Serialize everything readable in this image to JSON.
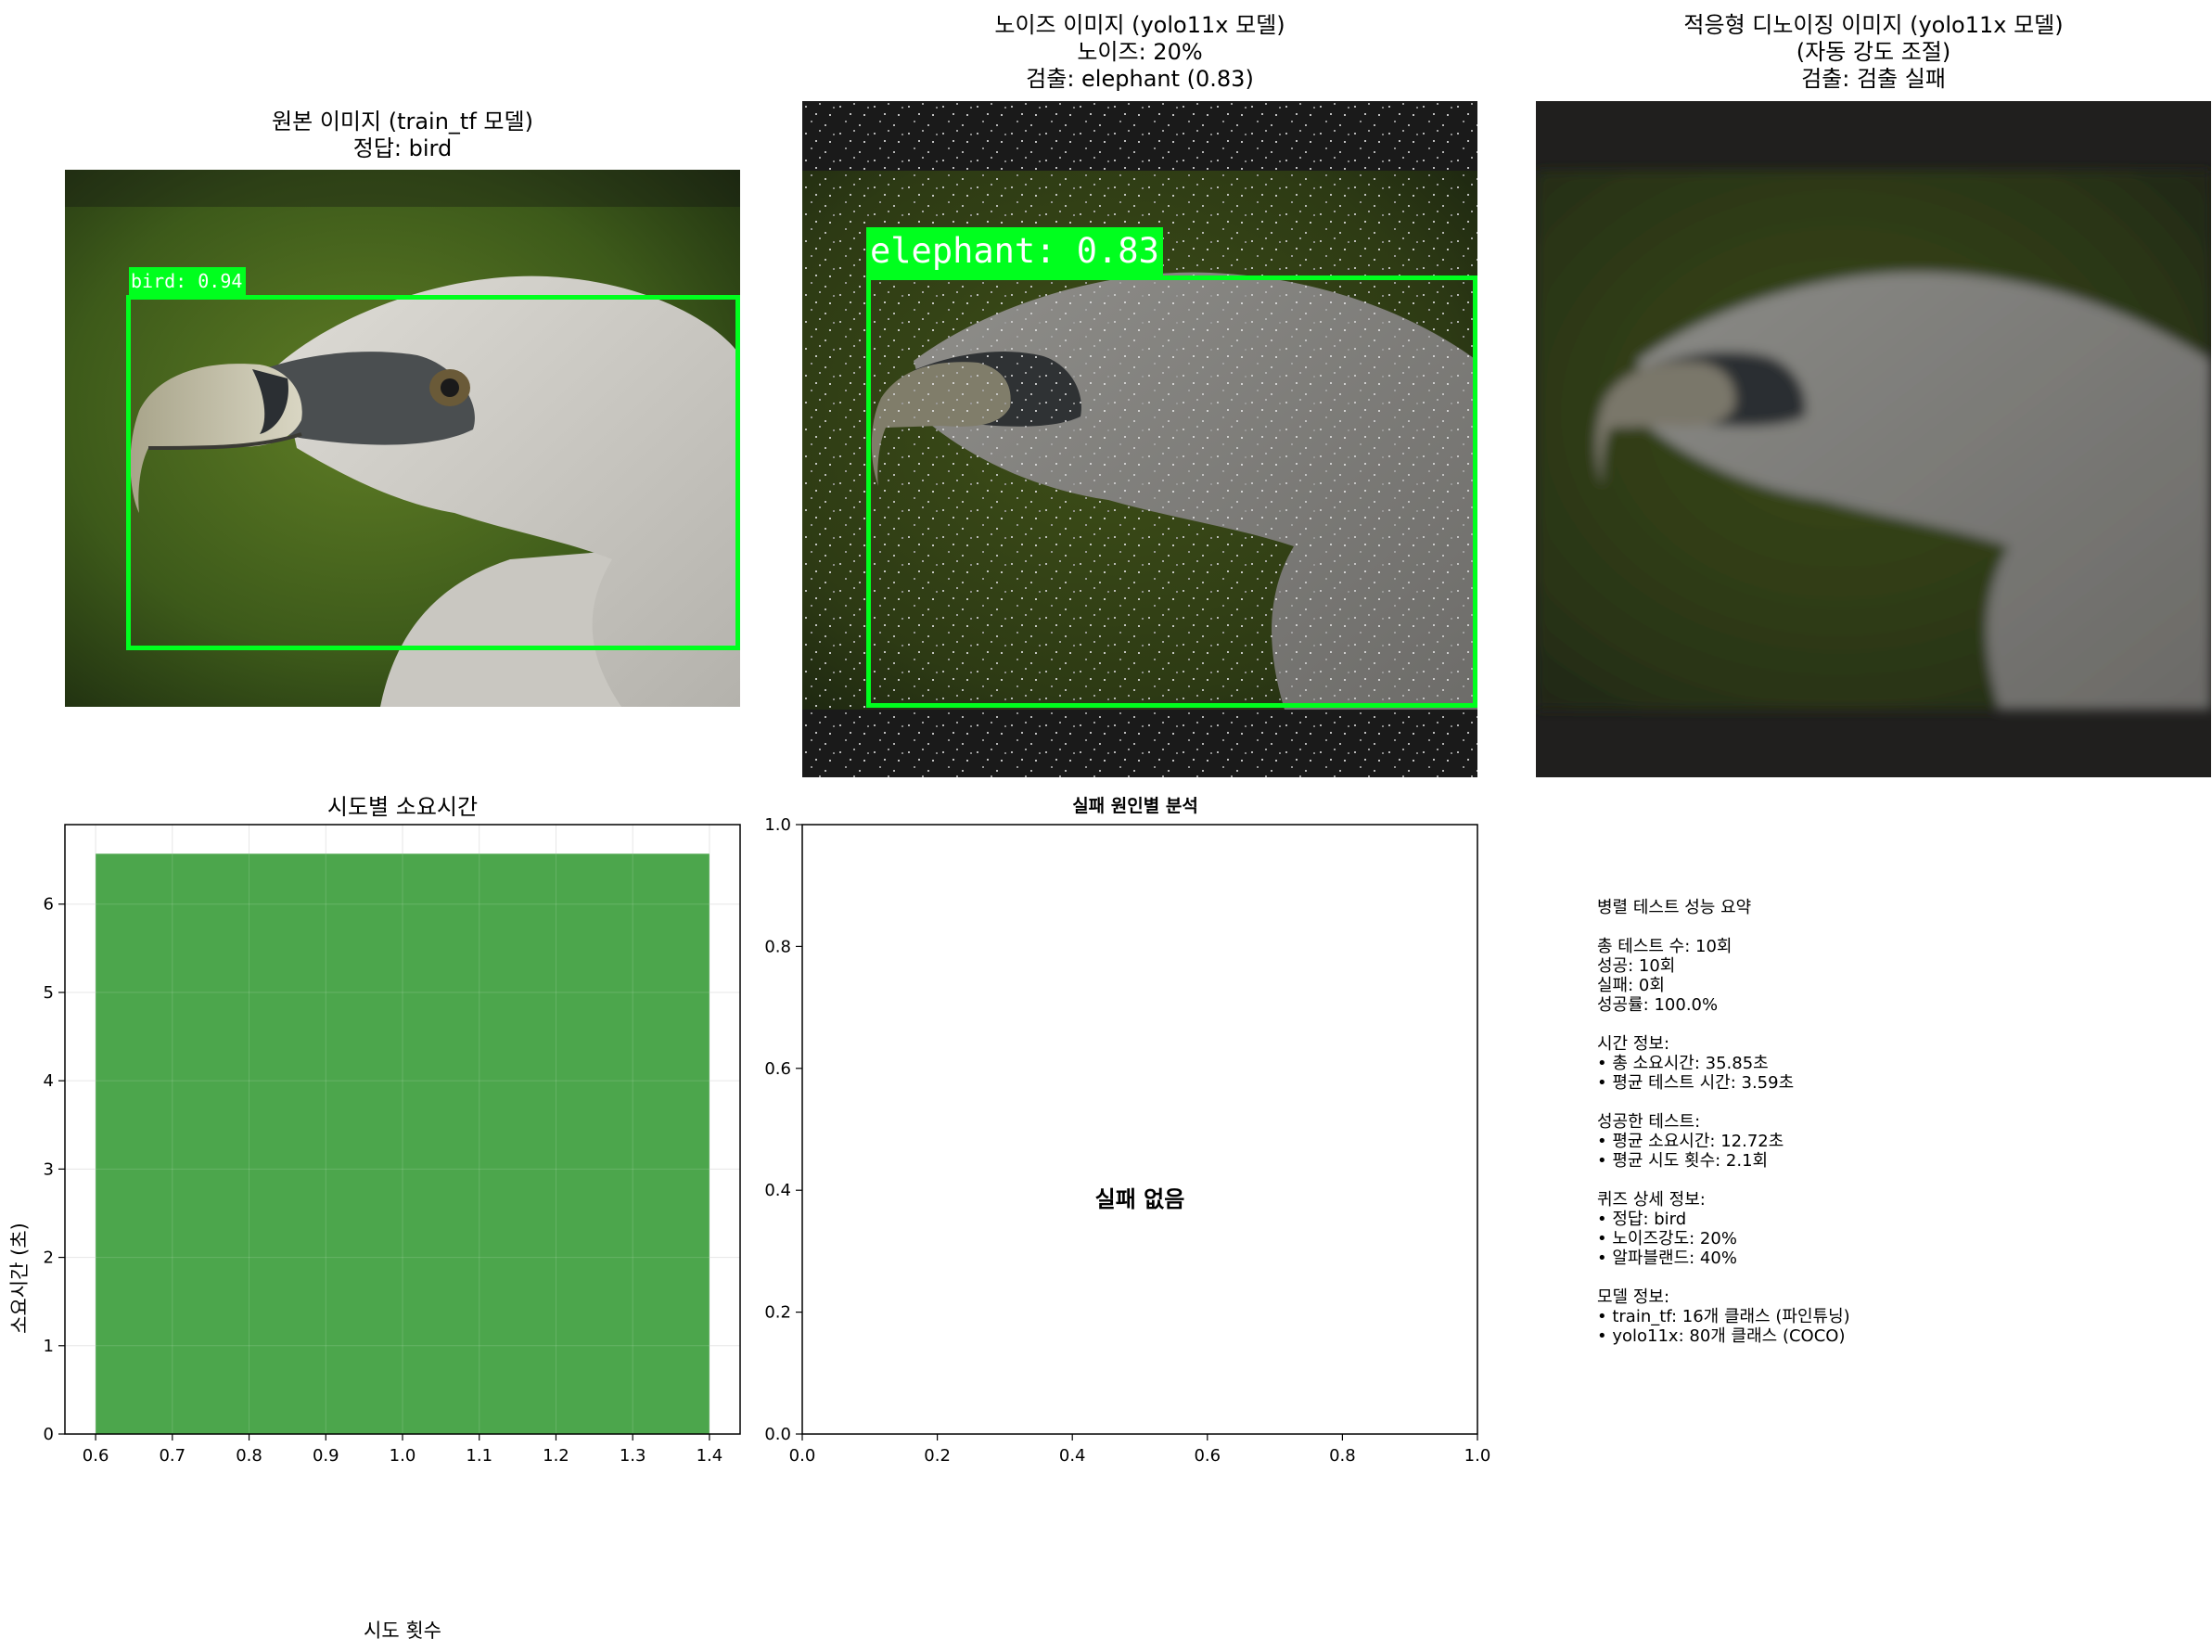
{
  "panels": {
    "original": {
      "title": "원본 이미지 (train_tf 모델)\n정답: bird",
      "detection_label": "bird: 0.94"
    },
    "noisy": {
      "title": "노이즈 이미지 (yolo11x 모델)\n노이즈: 20%\n검출: elephant (0.83)",
      "detection_label": "elephant: 0.83"
    },
    "denoised": {
      "title": "적응형 디노이징 이미지 (yolo11x 모델)\n(자동 강도 조절)\n검출: 검출 실패"
    }
  },
  "chart_data": [
    {
      "type": "bar",
      "title": "시도별 소요시간",
      "xlabel": "시도 횟수",
      "ylabel": "소요시간 (초)",
      "x": [
        1
      ],
      "values": [
        6.57
      ],
      "bar_width": 0.8,
      "xlim": [
        0.56,
        1.44
      ],
      "ylim": [
        0,
        6.9
      ],
      "xticks": [
        "0.6",
        "0.7",
        "0.8",
        "0.9",
        "1.0",
        "1.1",
        "1.2",
        "1.3",
        "1.4"
      ],
      "yticks": [
        "0",
        "1",
        "2",
        "3",
        "4",
        "5",
        "6"
      ],
      "grid": true,
      "color": "#4ca64c"
    },
    {
      "type": "bar",
      "title": "실패 원인별 분석",
      "annotation": "실패 없음",
      "xlim": [
        0,
        1
      ],
      "ylim": [
        0,
        1
      ],
      "xticks": [
        "0.0",
        "0.2",
        "0.4",
        "0.6",
        "0.8",
        "1.0"
      ],
      "yticks": [
        "0.0",
        "0.2",
        "0.4",
        "0.6",
        "0.8",
        "1.0"
      ],
      "values": []
    }
  ],
  "summary": {
    "text": "병렬 테스트 성능 요약\n\n총 테스트 수: 10회\n성공: 10회\n실패: 0회\n성공률: 100.0%\n\n시간 정보:\n• 총 소요시간: 35.85초\n• 평균 테스트 시간: 3.59초\n\n성공한 테스트:\n• 평균 소요시간: 12.72초\n• 평균 시도 횟수: 2.1회\n\n퀴즈 상세 정보:\n• 정답: bird\n• 노이즈강도: 20%\n• 알파블랜드: 40%\n\n모델 정보:\n• train_tf: 16개 클래스 (파인튜닝)\n• yolo11x: 80개 클래스 (COCO)"
  }
}
